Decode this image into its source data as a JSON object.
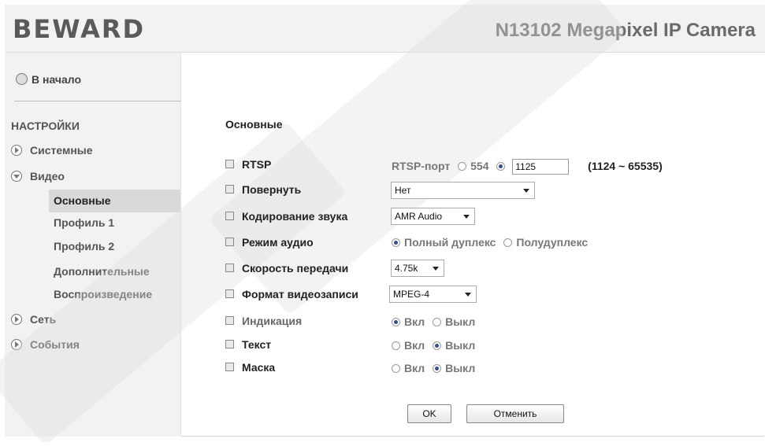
{
  "header": {
    "logo": "BEWARD",
    "product_title": "N13102 Megapixel IP Camera"
  },
  "sidebar": {
    "home_label": "В начало",
    "settings_title": "НАСТРОЙКИ",
    "items": [
      {
        "label": "Системные",
        "expanded": false
      },
      {
        "label": "Видео",
        "expanded": true
      },
      {
        "label": "Сеть",
        "expanded": false
      },
      {
        "label": "События",
        "expanded": false
      }
    ],
    "video_subitems": [
      "Основные",
      "Профиль 1",
      "Профиль 2",
      "Дополнительные",
      "Воспроизведение"
    ],
    "active_subitem": "Основные"
  },
  "content": {
    "title": "Основные",
    "rtsp": {
      "label": "RTSP",
      "port_label": "RTSP-порт",
      "option1": "554",
      "port_value": "1125",
      "range_text": "(1124 ~ 65535)",
      "selected": "custom"
    },
    "rotate": {
      "label": "Повернуть",
      "value": "Нет"
    },
    "audio_codec": {
      "label": "Кодирование звука",
      "value": "AMR Audio"
    },
    "audio_mode": {
      "label": "Режим аудио",
      "option_full": "Полный дуплекс",
      "option_half": "Полудуплекс",
      "selected": "full"
    },
    "bitrate": {
      "label": "Скорость передачи",
      "value": "4.75k"
    },
    "record_format": {
      "label": "Формат видеозаписи",
      "value": "MPEG-4"
    },
    "indication": {
      "label": "Индикация",
      "on": "Вкл",
      "off": "Выкл",
      "selected": "on"
    },
    "text": {
      "label": "Текст",
      "on": "Вкл",
      "off": "Выкл",
      "selected": "off"
    },
    "mask": {
      "label": "Маска",
      "on": "Вкл",
      "off": "Выкл",
      "selected": "off"
    },
    "ok_label": "OK",
    "cancel_label": "Отменить"
  }
}
